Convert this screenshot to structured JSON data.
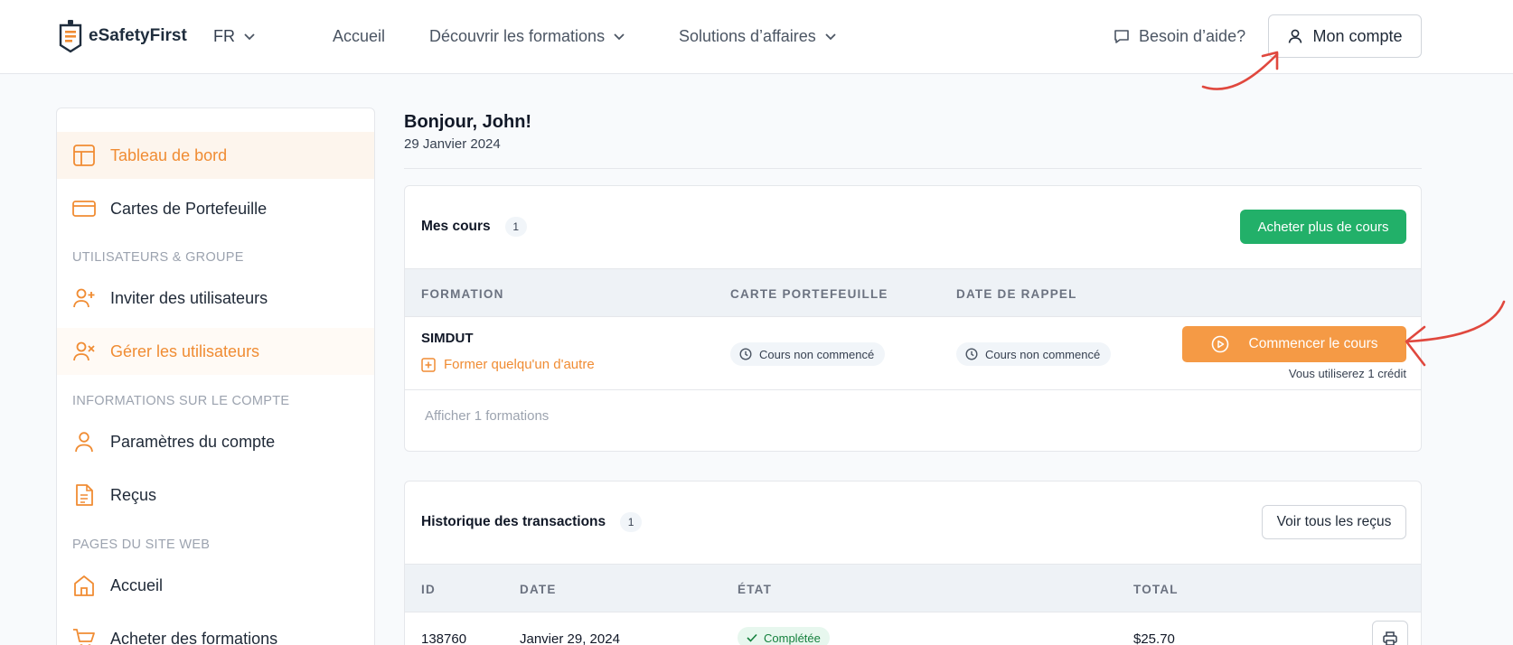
{
  "header": {
    "brand": "eSafetyFirst",
    "language": "FR",
    "nav": [
      {
        "label": "Accueil"
      },
      {
        "label": "Découvrir les formations"
      },
      {
        "label": "Solutions d’affaires"
      }
    ],
    "help": "Besoin d’aide?",
    "account": "Mon compte"
  },
  "sidebar": {
    "items": [
      {
        "label": "Tableau de bord",
        "icon": "layout-icon"
      },
      {
        "label": "Cartes de Portefeuille",
        "icon": "credit-card-icon"
      },
      {
        "label": "Inviter des utilisateurs",
        "icon": "user-plus-icon"
      },
      {
        "label": "Gérer les utilisateurs",
        "icon": "user-x-icon"
      },
      {
        "label": "Paramètres du compte",
        "icon": "user-icon"
      },
      {
        "label": "Reçus",
        "icon": "file-text-icon"
      },
      {
        "label": "Accueil",
        "icon": "home-icon"
      },
      {
        "label": "Acheter des formations",
        "icon": "cart-icon"
      }
    ],
    "sections": [
      "UTILISATEURS & GROUPE",
      "INFORMATIONS SUR LE COMPTE",
      "PAGES DU SITE WEB"
    ]
  },
  "main": {
    "greeting": "Bonjour, John!",
    "date": "29 Janvier 2024",
    "courses": {
      "title": "Mes cours",
      "count": "1",
      "buy_button": "Acheter plus de cours",
      "columns": [
        "FORMATION",
        "CARTE PORTEFEUILLE",
        "DATE DE RAPPEL"
      ],
      "row": {
        "name": "SIMDUT",
        "train_other": "Former quelqu'un d'autre",
        "wallet_status": "Cours non commencé",
        "reminder_status": "Cours non commencé",
        "start_button": "Commencer le cours",
        "credit_note": "Vous utiliserez 1 crédit"
      },
      "show_more": "Afficher 1 formations"
    },
    "transactions": {
      "title": "Historique des transactions",
      "count": "1",
      "view_button": "Voir tous les reçus",
      "columns": [
        "ID",
        "DATE",
        "ÉTAT",
        "TOTAL"
      ],
      "row": {
        "id": "138760",
        "date": "Janvier 29, 2024",
        "status": "Complétée",
        "total": "$25.70"
      }
    }
  },
  "colors": {
    "accent": "#f08c33",
    "primary_green": "#22b069",
    "annotation_red": "#e0483e"
  }
}
